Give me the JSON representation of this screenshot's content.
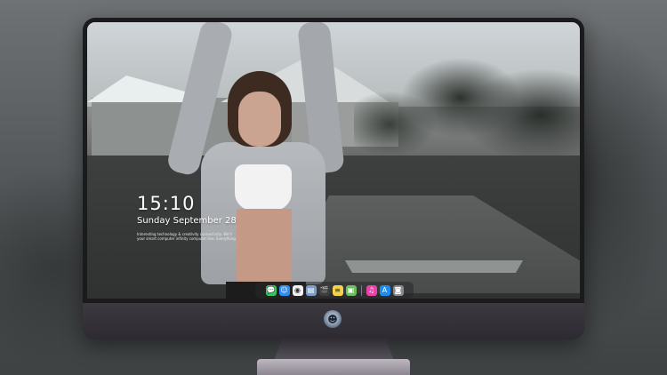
{
  "lock_screen": {
    "time": "15:10",
    "date": "Sunday September 28",
    "info_text": "Interesting technology & creativity connectivity. We'll your smart computer infinity computer line. Everything."
  },
  "dock": {
    "apps": [
      {
        "name": "messages-app-icon",
        "glyph": "💬",
        "color": "#34c759"
      },
      {
        "name": "finder-app-icon",
        "glyph": "☺",
        "color": "#2f8df5"
      },
      {
        "name": "safari-app-icon",
        "glyph": "◉",
        "color": "#f2f2f2"
      },
      {
        "name": "preview-app-icon",
        "glyph": "▤",
        "color": "#7a9fc8"
      },
      {
        "name": "clapper-app-icon",
        "glyph": "🎬",
        "color": "#3d3d3d"
      },
      {
        "name": "notes-app-icon",
        "glyph": "≡",
        "color": "#f6d24a"
      },
      {
        "name": "photos-app-icon",
        "glyph": "▣",
        "color": "#6cbf5a"
      },
      {
        "name": "music-app-icon",
        "glyph": "♫",
        "color": "#e843a8"
      },
      {
        "name": "app-store-app-icon",
        "glyph": "A",
        "color": "#1b8df2"
      },
      {
        "name": "camera-app-icon",
        "glyph": "◙",
        "color": "#8a8a8e"
      }
    ]
  },
  "monitor": {
    "logo_icon": "alien-logo-icon"
  }
}
